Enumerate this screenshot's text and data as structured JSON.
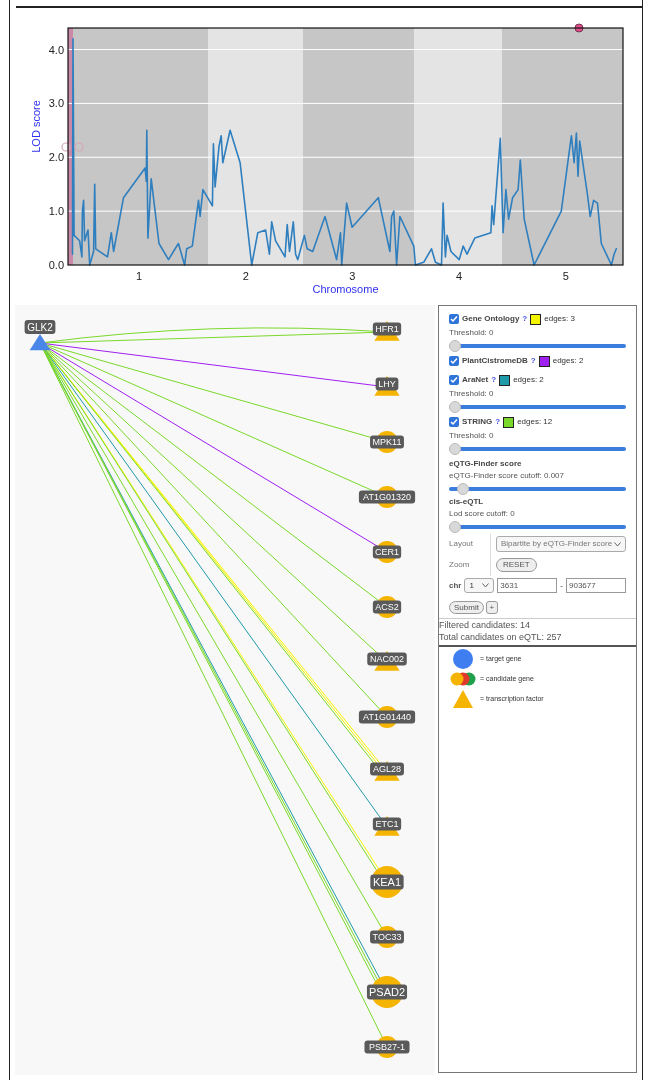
{
  "lod_chart": {
    "chart_data": {
      "type": "line",
      "grid": true,
      "xlabel": "Chromosome",
      "ylabel": "LOD score",
      "xlim": [
        0.334,
        5.536
      ],
      "ylim": [
        0,
        4.4
      ],
      "xticks": [
        {
          "value": 1,
          "label": "1"
        },
        {
          "value": 2,
          "label": "2"
        },
        {
          "value": 3,
          "label": "3"
        },
        {
          "value": 4,
          "label": "4"
        },
        {
          "value": 5,
          "label": "5"
        }
      ],
      "yticks": [
        {
          "value": 0,
          "label": "0.0"
        },
        {
          "value": 1,
          "label": "1.0"
        },
        {
          "value": 2,
          "label": "2.0"
        },
        {
          "value": 3,
          "label": "3.0"
        },
        {
          "value": 4,
          "label": "4.0"
        }
      ],
      "x": [
        0.376,
        0.381,
        0.391,
        0.443,
        0.464,
        0.469,
        0.48,
        0.49,
        0.521,
        0.537,
        0.574,
        0.584,
        0.594,
        0.704,
        0.74,
        0.761,
        0.854,
        1.057,
        1.068,
        1.073,
        1.083,
        1.114,
        1.187,
        1.276,
        1.369,
        1.427,
        1.447,
        1.499,
        1.557,
        1.572,
        1.598,
        1.687,
        1.697,
        1.713,
        1.749,
        1.77,
        1.785,
        1.853,
        1.947,
        2.056,
        2.113,
        2.186,
        2.222,
        2.243,
        2.28,
        2.368,
        2.389,
        2.41,
        2.446,
        2.467,
        2.488,
        2.55,
        2.576,
        2.628,
        2.743,
        2.852,
        2.888,
        2.899,
        2.945,
        2.997,
        3.242,
        3.351,
        3.367,
        3.388,
        3.414,
        3.445,
        3.575,
        3.59,
        3.668,
        3.741,
        3.778,
        3.835,
        3.85,
        3.871,
        3.887,
        3.923,
        4.001,
        4.038,
        4.074,
        4.147,
        4.298,
        4.308,
        4.324,
        4.386,
        4.412,
        4.438,
        4.464,
        4.501,
        4.553,
        4.573,
        4.61,
        4.703,
        4.958,
        5.052,
        5.078,
        5.099,
        5.114,
        5.13,
        5.203,
        5.229,
        5.26,
        5.297,
        5.333,
        5.427,
        5.453,
        5.473
      ],
      "series": [
        {
          "color": "#2f7fbf",
          "values": [
            0.2,
            4.2,
            0.55,
            0.45,
            0.15,
            1.0,
            1.2,
            0.45,
            0.65,
            0.0,
            0.25,
            1.5,
            0.3,
            0.15,
            0.6,
            0.25,
            1.25,
            1.8,
            1.55,
            2.5,
            0.5,
            1.6,
            0.4,
            0.1,
            0.4,
            0.0,
            0.3,
            0.35,
            1.2,
            0.9,
            1.4,
            1.1,
            2.25,
            1.45,
            2.2,
            2.4,
            1.9,
            2.5,
            1.9,
            0.0,
            0.6,
            0.65,
            0.2,
            0.8,
            0.45,
            0.15,
            0.75,
            0.25,
            0.8,
            0.2,
            0.1,
            0.55,
            0.3,
            0.25,
            0.9,
            0.1,
            0.6,
            0.0,
            1.15,
            0.7,
            1.25,
            0.25,
            0.9,
            1.0,
            0.0,
            0.9,
            0.35,
            0.0,
            0.05,
            0.3,
            0.05,
            0.0,
            1.15,
            0.15,
            0.55,
            0.25,
            0.1,
            0.35,
            0.2,
            0.5,
            0.6,
            1.1,
            0.75,
            2.35,
            0.6,
            1.4,
            0.85,
            1.25,
            1.4,
            1.95,
            0.85,
            0.0,
            1.0,
            2.4,
            1.9,
            2.45,
            1.65,
            2.3,
            1.3,
            0.9,
            1.2,
            1.15,
            0.4,
            0.0,
            0.2,
            0.3
          ]
        }
      ]
    }
  },
  "network": {
    "source": {
      "label": "GLK2",
      "kind": "triangle",
      "color": "#4a86e8"
    },
    "targets": [
      {
        "label": "HFR1",
        "kind": "triangle",
        "large": false,
        "edges": [
          {
            "kind": "string"
          },
          {
            "kind": "string"
          }
        ]
      },
      {
        "label": "LHY",
        "kind": "triangle",
        "large": false,
        "edges": [
          {
            "kind": "pcdb"
          }
        ]
      },
      {
        "label": "MPK11",
        "kind": "circle",
        "large": false,
        "edges": [
          {
            "kind": "string"
          }
        ]
      },
      {
        "label": "AT1G01320",
        "kind": "circle",
        "large": false,
        "edges": [
          {
            "kind": "string"
          }
        ]
      },
      {
        "label": "CER1",
        "kind": "circle",
        "large": false,
        "edges": [
          {
            "kind": "pcdb"
          }
        ]
      },
      {
        "label": "ACS2",
        "kind": "circle",
        "large": false,
        "edges": [
          {
            "kind": "string"
          }
        ]
      },
      {
        "label": "NAC002",
        "kind": "triangle",
        "large": false,
        "edges": [
          {
            "kind": "string"
          }
        ]
      },
      {
        "label": "AT1G01440",
        "kind": "circle",
        "large": false,
        "edges": [
          {
            "kind": "string"
          }
        ]
      },
      {
        "label": "AGL28",
        "kind": "triangle",
        "large": false,
        "edges": [
          {
            "kind": "go"
          },
          {
            "kind": "go"
          },
          {
            "kind": "string"
          }
        ]
      },
      {
        "label": "ETC1",
        "kind": "triangle",
        "large": false,
        "edges": [
          {
            "kind": "aranet"
          }
        ]
      },
      {
        "label": "KEA1",
        "kind": "circle",
        "large": true,
        "edges": [
          {
            "kind": "go"
          },
          {
            "kind": "string"
          }
        ]
      },
      {
        "label": "TOC33",
        "kind": "circle",
        "large": false,
        "edges": [
          {
            "kind": "string"
          }
        ]
      },
      {
        "label": "PSAD2",
        "kind": "circle",
        "large": true,
        "edges": [
          {
            "kind": "aranet"
          },
          {
            "kind": "string"
          },
          {
            "kind": "string"
          }
        ]
      },
      {
        "label": "PSB27-1",
        "kind": "circle",
        "large": false,
        "edges": [
          {
            "kind": "string"
          }
        ]
      }
    ]
  },
  "panel": {
    "sources": [
      {
        "kind": "go",
        "label": "Gene Ontology",
        "help": "?",
        "color": "#f5f500",
        "edges": "edges: 3",
        "checked": true,
        "threshold": {
          "label": "Threshold: 0",
          "level": 0
        }
      },
      {
        "kind": "pcdb",
        "label": "PlantCistromeDB",
        "help": "?",
        "color": "#a020f0",
        "edges": "edges: 2",
        "checked": true
      },
      {
        "kind": "aranet",
        "label": "AraNet",
        "help": "?",
        "color": "#1f9aa8",
        "edges": "edges: 2",
        "checked": true,
        "threshold": {
          "label": "Threshold: 0",
          "level": 0
        }
      },
      {
        "kind": "string",
        "label": "STRING",
        "help": "?",
        "color": "#7ad82a",
        "edges": "edges: 12",
        "checked": true,
        "threshold": {
          "label": "Threshold: 0",
          "level": 0
        }
      }
    ],
    "scores": [
      {
        "title": "eQTG-Finder score",
        "label": "eQTG-Finder score cutoff: 0.007",
        "level": 0.05
      },
      {
        "title": "cis-eQTL",
        "label": "Lod score cutoff: 0",
        "level": 0
      }
    ],
    "layout": {
      "label": "Layout",
      "value": "Bipartite by eQTG-Finder score"
    },
    "zoom": {
      "label": "Zoom",
      "button": "RESET"
    },
    "region": {
      "label": "chr",
      "chr": "1",
      "start": "3631",
      "separator": "-",
      "end": "903677"
    },
    "submit": "Submit",
    "add": "+",
    "stats": [
      "Filtered candidates: 14",
      "Total candidates on eQTL: 257"
    ],
    "legend": [
      {
        "kind": "target",
        "text": "= target gene"
      },
      {
        "kind": "candidate",
        "text": "= candidate gene"
      },
      {
        "kind": "tf",
        "text": "= transcription factor"
      }
    ]
  }
}
